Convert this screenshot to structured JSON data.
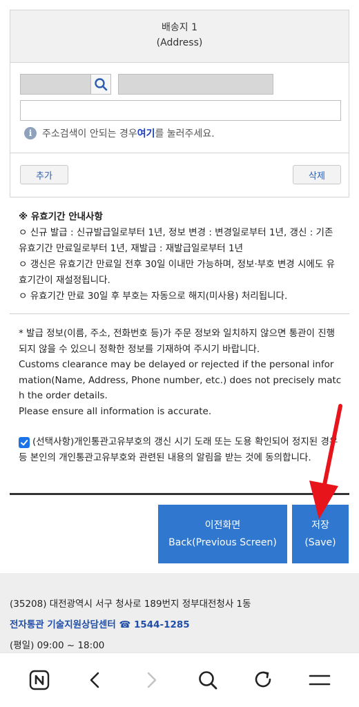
{
  "address": {
    "title": "배송지 1",
    "subtitle": "(Address)",
    "zipcode_value": "",
    "address1_value": "",
    "address2_value": "",
    "info_prefix": "주소검색이 안되는 경우 ",
    "info_link": "여기",
    "info_suffix": "를 눌러주세요.",
    "add_label": "추가",
    "delete_label": "삭제"
  },
  "notice": {
    "title": "※ 유효기간 안내사항",
    "lines": [
      "ㅇ 신규 발급 : 신규발급일로부터 1년, 정보 변경 : 변경일로부터 1년, 갱신 : 기존 유효기간 만료일로부터 1년, 재발급 : 재발급일로부터 1년",
      "ㅇ 갱신은 유효기간 만료일 전후 30일 이내만 가능하며, 정보·부호 변경 시에도 유효기간이 재설정됩니다.",
      "ㅇ 유효기간 만료 30일 후 부호는 자동으로 해지(미사용) 처리됩니다."
    ]
  },
  "warning": {
    "korean": "* 발급 정보(이름, 주소, 전화번호 등)가 주문 정보와 일치하지 않으면 통관이 진행되지 않을 수 있으니 정확한 정보를 기재하여 주시기 바랍니다.",
    "english1": "Customs clearance may be delayed or rejected if the personal information(Name, Address, Phone number, etc.) does not precisely match the order details.",
    "english2": "Please ensure all information is accurate."
  },
  "consent": {
    "checked": true,
    "text": "(선택사항)개인통관고유부호의 갱신 시기 도래 또는 도용 확인되어 정지된 경우 등 본인의 개인통관고유부호와 관련된 내용의 알림을 받는 것에 동의합니다."
  },
  "buttons": {
    "back_ko": "이전화면",
    "back_en": "Back(Previous Screen)",
    "save_ko": "저장",
    "save_en": "(Save)"
  },
  "footer": {
    "address": "(35208) 대전광역시 서구 청사로 189번지 정부대전청사 1동",
    "center": "전자통관 기술지원상담센터 ☎ 1544-1285",
    "hours": "(평일) 09:00 ~ 18:00"
  },
  "colors": {
    "primary_button": "#2f77cf",
    "link": "#1a3cc2",
    "annotation_arrow": "#e8141c"
  },
  "icons": {
    "search": "search-icon",
    "info": "info-icon",
    "checkbox": "checkbox-checked-icon",
    "nav": [
      "naver-home-icon",
      "back-icon",
      "forward-icon",
      "search-icon",
      "refresh-icon",
      "menu-icon"
    ]
  }
}
